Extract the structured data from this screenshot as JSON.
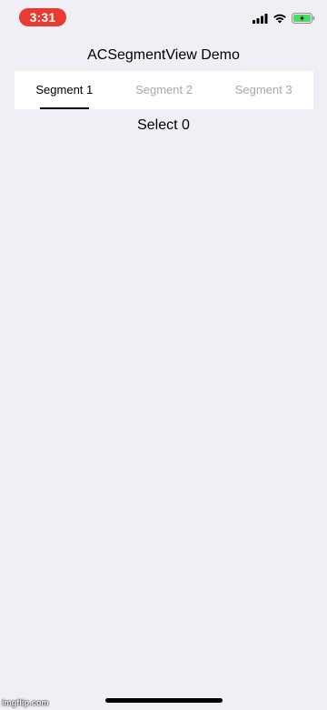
{
  "status_bar": {
    "time": "3:31",
    "time_pill_color": "#eb3a30",
    "icons": [
      "cellular-signal-icon",
      "wifi-icon",
      "battery-charging-icon"
    ],
    "battery_color": "#4cd964"
  },
  "header": {
    "title": "ACSegmentView Demo"
  },
  "segments": {
    "selected_index": 0,
    "tabs": [
      {
        "label": "Segment 1",
        "selected": true
      },
      {
        "label": "Segment 2",
        "selected": false
      },
      {
        "label": "Segment 3",
        "selected": false
      }
    ],
    "selected_color": "#000000",
    "unselected_color": "#a8a8ad"
  },
  "content": {
    "select_label": "Select 0"
  },
  "watermark": {
    "text": "imgflip.com"
  }
}
